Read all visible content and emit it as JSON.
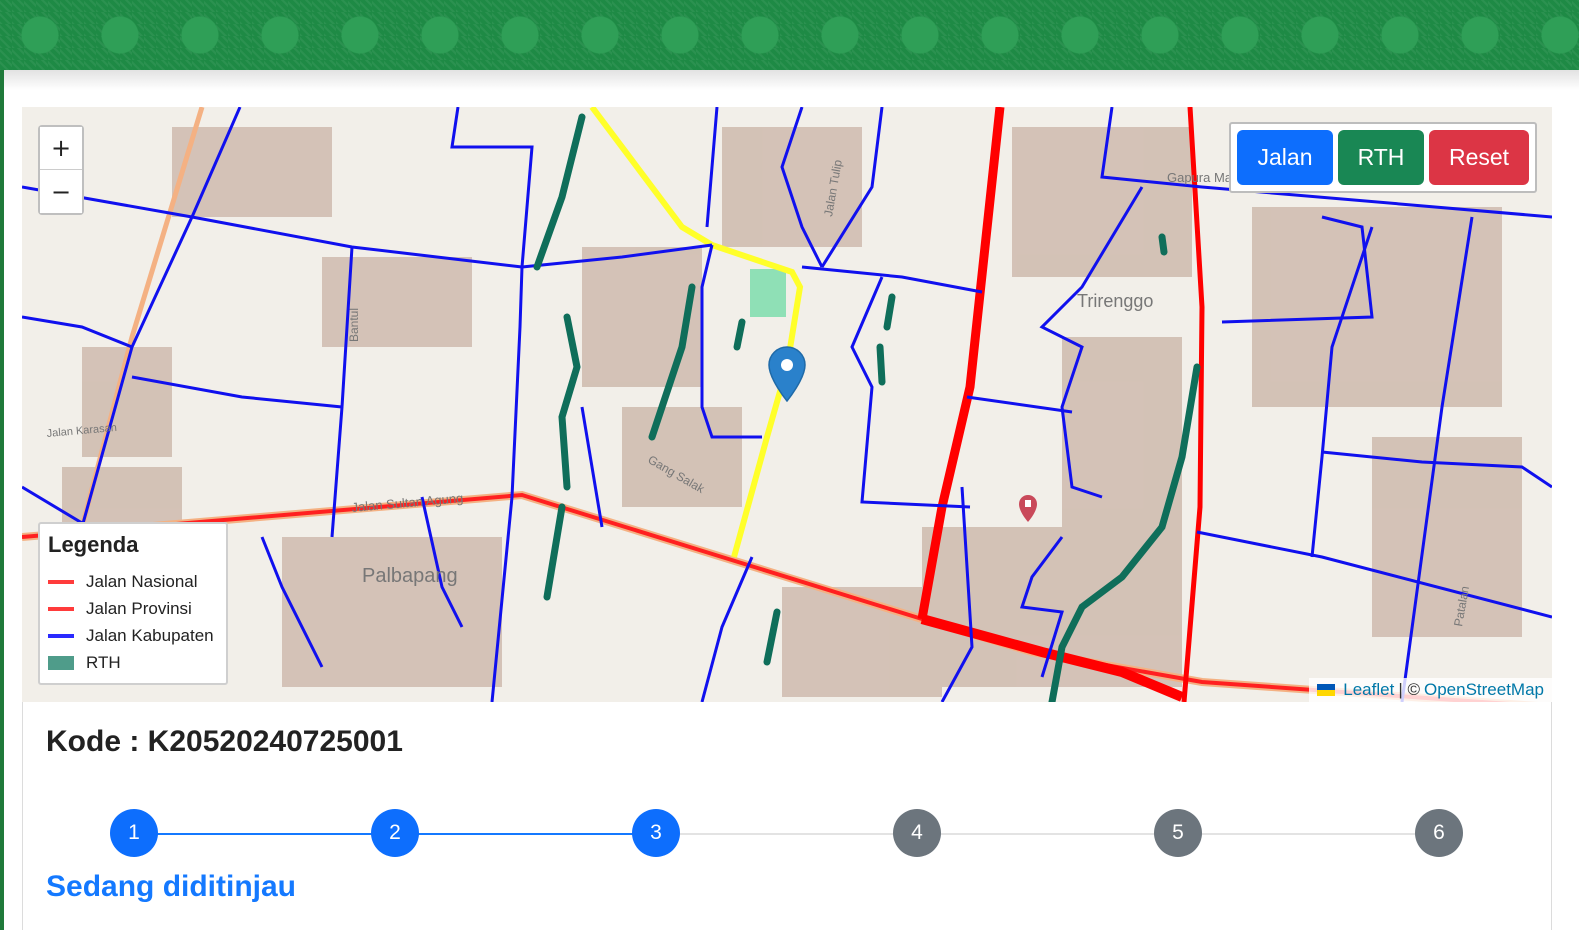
{
  "map": {
    "zoom_in": "+",
    "zoom_out": "−",
    "layer_buttons": {
      "jalan": "Jalan",
      "rth": "RTH",
      "reset": "Reset"
    },
    "legend": {
      "title": "Legenda",
      "items": [
        {
          "label": "Jalan Nasional",
          "color": "#ff3b3b"
        },
        {
          "label": "Jalan Provinsi",
          "color": "#ff3b3b"
        },
        {
          "label": "Jalan Kabupaten",
          "color": "#2a2aff"
        },
        {
          "label": "RTH",
          "color": "#4f9c8a"
        }
      ]
    },
    "attribution": {
      "leaflet": "Leaflet",
      "separator": "| ©",
      "osm": "OpenStreetMap"
    },
    "place_labels": {
      "label_1": "Palbapang",
      "label_2": "Trirenggo",
      "label_3": "Jalan Sultan Agung",
      "label_4": "Gang Salak",
      "label_5": "Bantul",
      "label_6": "Gapura Manding",
      "label_7": "Jalan Karasan",
      "label_8": "Jalan Tulip",
      "label_9": "Patalan"
    }
  },
  "kode": {
    "label": "Kode : K20520240725001"
  },
  "stepper": {
    "steps": [
      "1",
      "2",
      "3",
      "4",
      "5",
      "6"
    ],
    "current": 3
  },
  "status": {
    "text": "Sedang diditinjau"
  },
  "colors": {
    "primary": "#0d6efd",
    "success": "#198754",
    "danger": "#dc3545",
    "secondary": "#6c757d"
  }
}
